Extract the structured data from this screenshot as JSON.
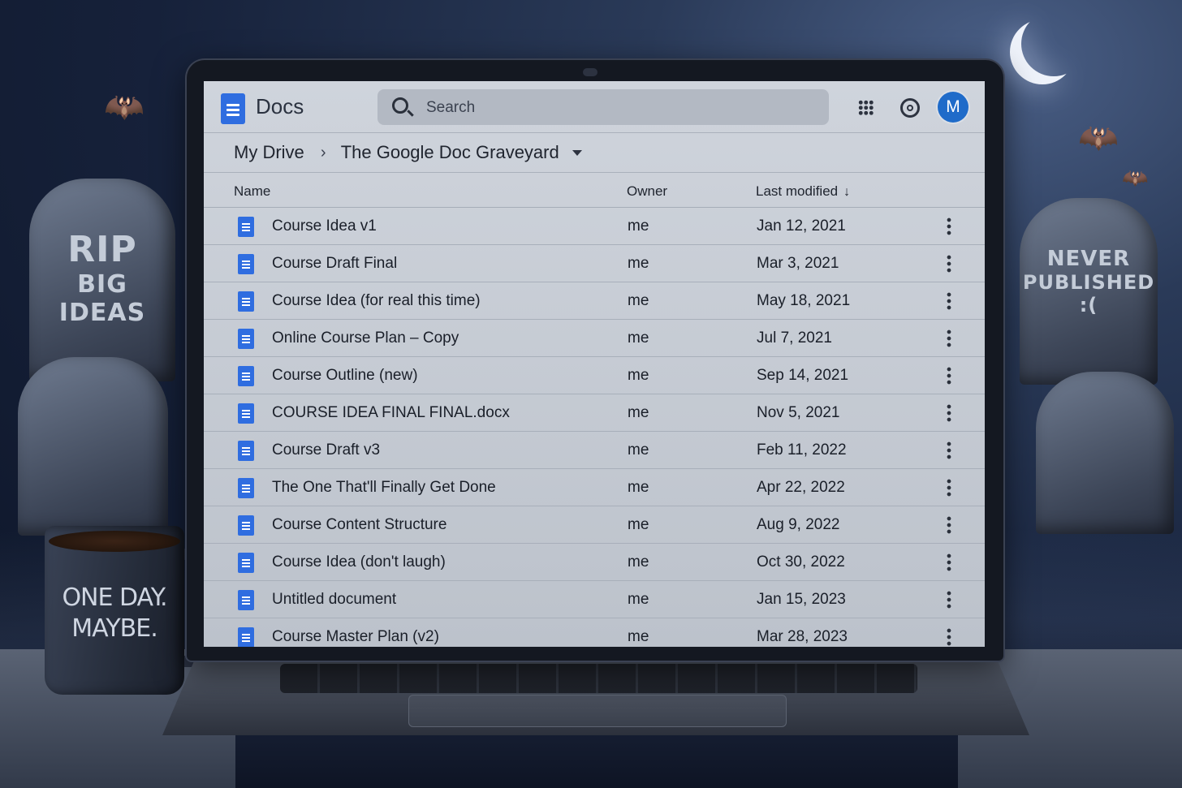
{
  "app": {
    "name": "Docs",
    "accent": "#2f6de0"
  },
  "search": {
    "placeholder": "Search"
  },
  "header_icons": [
    "apps-grid-icon",
    "settings-icon"
  ],
  "account": {
    "initial": "M",
    "color": "#1f6bc9"
  },
  "breadcrumb": {
    "root": "My Drive",
    "separator": "›",
    "current": "The Google Doc Graveyard"
  },
  "columns": {
    "name": "Name",
    "owner": "Owner",
    "modified": "Last modified",
    "sort_indicator": "↓"
  },
  "files": [
    {
      "name": "Course Idea v1",
      "owner": "me",
      "modified": "Jan 12, 2021"
    },
    {
      "name": "Course Draft Final",
      "owner": "me",
      "modified": "Mar 3, 2021"
    },
    {
      "name": "Course Idea (for real this time)",
      "owner": "me",
      "modified": "May 18, 2021"
    },
    {
      "name": "Online Course Plan – Copy",
      "owner": "me",
      "modified": "Jul 7, 2021"
    },
    {
      "name": "Course Outline (new)",
      "owner": "me",
      "modified": "Sep 14, 2021"
    },
    {
      "name": "COURSE IDEA FINAL FINAL.docx",
      "owner": "me",
      "modified": "Nov 5, 2021"
    },
    {
      "name": "Course Draft v3",
      "owner": "me",
      "modified": "Feb 11, 2022"
    },
    {
      "name": "The One That'll Finally Get Done",
      "owner": "me",
      "modified": "Apr 22, 2022"
    },
    {
      "name": "Course Content Structure",
      "owner": "me",
      "modified": "Aug 9, 2022"
    },
    {
      "name": "Course Idea (don't laugh)",
      "owner": "me",
      "modified": "Oct 30, 2022"
    },
    {
      "name": "Untitled document",
      "owner": "me",
      "modified": "Jan 15, 2023"
    },
    {
      "name": "Course Master Plan (v2)",
      "owner": "me",
      "modified": "Mar 28, 2023"
    }
  ],
  "scene": {
    "tombstone_left": [
      "RIP",
      "BIG",
      "IDEAS"
    ],
    "tombstone_right": [
      "NEVER",
      "PUBLISHED",
      ":("
    ],
    "mug": [
      "ONE DAY.",
      "MAYBE."
    ]
  }
}
